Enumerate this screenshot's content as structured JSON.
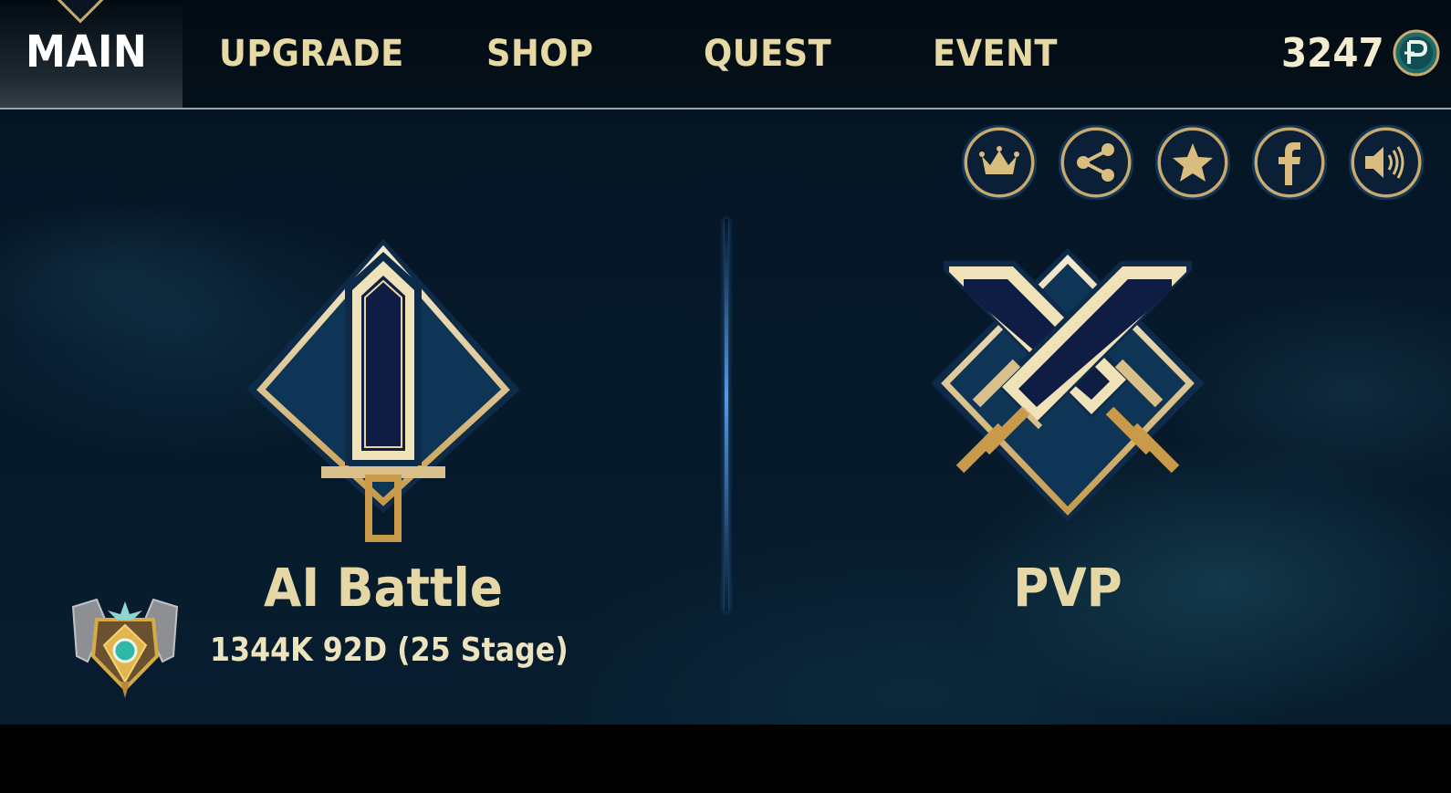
{
  "nav": {
    "tabs": [
      {
        "label": "MAIN",
        "active": true
      },
      {
        "label": "UPGRADE",
        "active": false
      },
      {
        "label": "SHOP",
        "active": false
      },
      {
        "label": "QUEST",
        "active": false
      },
      {
        "label": "EVENT",
        "active": false
      }
    ],
    "currency": {
      "amount": "3247",
      "icon": "coin-icon"
    }
  },
  "actions": [
    {
      "name": "ranking",
      "icon": "crown-icon"
    },
    {
      "name": "share",
      "icon": "share-icon"
    },
    {
      "name": "rate",
      "icon": "star-icon"
    },
    {
      "name": "facebook",
      "icon": "facebook-icon"
    },
    {
      "name": "sound",
      "icon": "speaker-icon"
    }
  ],
  "modes": {
    "ai_battle": {
      "title": "AI Battle",
      "icon": "sword-icon"
    },
    "pvp": {
      "title": "PVP",
      "icon": "crossed-swords-icon"
    }
  },
  "rank": {
    "info": "1344K 92D (25 Stage)",
    "icon": "rank-badge-icon"
  },
  "colors": {
    "gold": "#c8aa6e",
    "gold_light": "#f0e2b4",
    "nav_text": "#e6d9a4",
    "navy": "#0f1d45",
    "panel_blue": "#0f3556",
    "divider": "#4a9bff",
    "background": "#06192a"
  }
}
